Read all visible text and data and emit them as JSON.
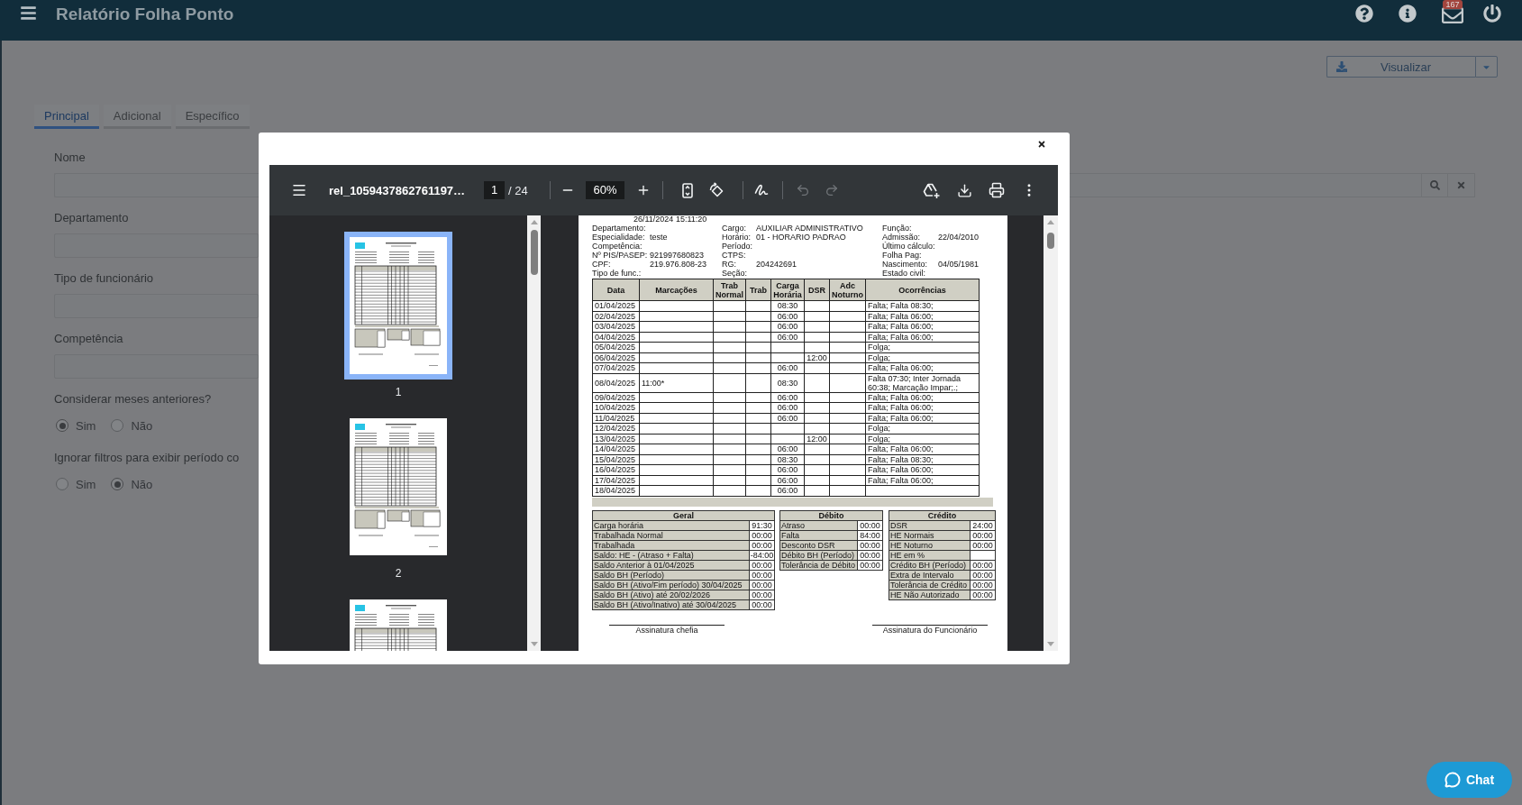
{
  "header": {
    "title": "Relatório Folha Ponto",
    "notification_count": "167"
  },
  "actions": {
    "view_button": "Visualizar"
  },
  "tabs": [
    {
      "label": "Principal",
      "selected": true
    },
    {
      "label": "Adicional",
      "selected": false
    },
    {
      "label": "Específico",
      "selected": false
    }
  ],
  "form": {
    "fields": [
      {
        "kind": "search",
        "label": "Nome"
      },
      {
        "kind": "text",
        "label": "Departamento"
      },
      {
        "kind": "text",
        "label": "Tipo de funcionário"
      },
      {
        "kind": "text",
        "label": "Competência"
      }
    ],
    "radio_groups": [
      {
        "label": "Considerar meses anteriores?",
        "options": [
          {
            "label": "Sim",
            "selected": true
          },
          {
            "label": "Não",
            "selected": false
          }
        ]
      },
      {
        "label": "Ignorar filtros para exibir período co",
        "options": [
          {
            "label": "Sim",
            "selected": false
          },
          {
            "label": "Não",
            "selected": true
          }
        ]
      }
    ]
  },
  "modal": {
    "viewer": {
      "file_name": "rel_1059437862761197…",
      "page": "1",
      "page_count": "/ 24",
      "zoom": "60%",
      "undo": {
        "disabled": true
      },
      "redo": {
        "disabled": true
      },
      "thumbnails": [
        {
          "label": "1",
          "selected": true
        },
        {
          "label": "2",
          "selected": false
        },
        {
          "selected": false
        }
      ],
      "document": {
        "timestamp": "26/11/2024 15:11:20",
        "info": [
          [
            {
              "label": "Departamento:"
            },
            {
              "label": "Cargo:",
              "value": "AUXILIAR ADMINISTRATIVO"
            },
            {
              "label": "Função:"
            }
          ],
          [
            {
              "label": "Especialidade:",
              "value": "teste"
            },
            {
              "label": "Horário:",
              "value": "01 - HORARIO PADRAO"
            },
            {
              "label": "Admissão:",
              "value": "22/04/2010"
            }
          ],
          [
            {
              "label": "Competência:"
            },
            {
              "label": "Período:"
            },
            {
              "label": "Último cálculo:"
            }
          ],
          [
            {
              "label": "Nº PIS/PASEP:",
              "value": "921997680823"
            },
            {
              "label": "CTPS:"
            },
            {
              "label": "Folha Pag:"
            }
          ],
          [
            {
              "label": "CPF:",
              "value": "219.976.808-23"
            },
            {
              "label": "RG:",
              "value": "204242691"
            },
            {
              "label": "Nascimento:",
              "value": "04/05/1981"
            }
          ],
          [
            {
              "label": "Tipo de func.:"
            },
            {
              "label": "Seção:"
            },
            {
              "label": "Estado civil:"
            }
          ]
        ],
        "table": {
          "columns": [
            "Data",
            "Marcações",
            "Trab Normal",
            "Trab",
            "Carga Horária",
            "DSR",
            "Adc Noturno",
            "Ocorrências"
          ],
          "rows": [
            {
              "data": "01/04/2025",
              "carga_horaria": "08:30",
              "ocorrencias": "Falta; Falta 08:30;"
            },
            {
              "data": "02/04/2025",
              "carga_horaria": "06:00",
              "ocorrencias": "Falta; Falta 06:00;"
            },
            {
              "data": "03/04/2025",
              "carga_horaria": "06:00",
              "ocorrencias": "Falta; Falta 06:00;"
            },
            {
              "data": "04/04/2025",
              "carga_horaria": "06:00",
              "ocorrencias": "Falta; Falta 06:00;"
            },
            {
              "data": "05/04/2025",
              "ocorrencias": "Folga;"
            },
            {
              "data": "06/04/2025",
              "dsr": "12:00",
              "ocorrencias": "Folga;"
            },
            {
              "data": "07/04/2025",
              "carga_horaria": "06:00",
              "ocorrencias": "Falta; Falta 06:00;"
            },
            {
              "data": "08/04/2025",
              "marcacoes": "11:00*",
              "carga_horaria": "08:30",
              "ocorrencias": "Falta 07:30; Inter Jornada 60:38; Marcação Impar;.;"
            },
            {
              "data": "09/04/2025",
              "carga_horaria": "06:00",
              "ocorrencias": "Falta; Falta 06:00;"
            },
            {
              "data": "10/04/2025",
              "carga_horaria": "06:00",
              "ocorrencias": "Falta; Falta 06:00;"
            },
            {
              "data": "11/04/2025",
              "carga_horaria": "06:00",
              "ocorrencias": "Falta; Falta 06:00;"
            },
            {
              "data": "12/04/2025",
              "ocorrencias": "Folga;"
            },
            {
              "data": "13/04/2025",
              "dsr": "12:00",
              "ocorrencias": "Folga;"
            },
            {
              "data": "14/04/2025",
              "carga_horaria": "06:00",
              "ocorrencias": "Falta; Falta 06:00;"
            },
            {
              "data": "15/04/2025",
              "carga_horaria": "08:30",
              "ocorrencias": "Falta; Falta 08:30;"
            },
            {
              "data": "16/04/2025",
              "carga_horaria": "06:00",
              "ocorrencias": "Falta; Falta 06:00;"
            },
            {
              "data": "17/04/2025",
              "carga_horaria": "06:00",
              "ocorrencias": "Falta; Falta 06:00;"
            },
            {
              "data": "18/04/2025",
              "carga_horaria": "06:00"
            }
          ]
        },
        "summary": [
          {
            "title": "Geral",
            "rows": [
              {
                "label": "Carga horária",
                "value": "91:30"
              },
              {
                "label": "Trabalhada Normal",
                "value": "00:00"
              },
              {
                "label": "Trabalhada",
                "value": "00:00"
              },
              {
                "label": "Saldo: HE - (Atraso + Falta)",
                "value": "-84:00"
              },
              {
                "label": "Saldo Anterior à 01/04/2025",
                "value": "00:00"
              },
              {
                "label": "Saldo BH (Período)",
                "value": "00:00"
              },
              {
                "label": "Saldo BH (Ativo/Fim período) 30/04/2025",
                "value": "00:00"
              },
              {
                "label": "Saldo BH (Ativo) até 20/02/2026",
                "value": "00:00"
              },
              {
                "label": "Saldo BH (Ativo/Inativo) até 30/04/2025",
                "value": "00:00"
              }
            ]
          },
          {
            "title": "Débito",
            "rows": [
              {
                "label": "Atraso",
                "value": "00:00"
              },
              {
                "label": "Falta",
                "value": "84:00"
              },
              {
                "label": "Desconto DSR",
                "value": "00:00"
              },
              {
                "label": "Débito BH (Período)",
                "value": "00:00"
              },
              {
                "label": "Tolerância de Débito",
                "value": "00:00"
              }
            ]
          },
          {
            "title": "Crédito",
            "rows": [
              {
                "label": "DSR",
                "value": "24:00"
              },
              {
                "label": "HE Normais",
                "value": "00:00"
              },
              {
                "label": "HE Noturno",
                "value": "00:00"
              },
              {
                "label": "HE em %"
              },
              {
                "label": "Crédito BH (Período)",
                "value": "00:00"
              },
              {
                "label": "Extra de Intervalo",
                "value": "00:00"
              },
              {
                "label": "Tolerância de Crédito",
                "value": "00:00"
              },
              {
                "label": "HE Não Autorizado",
                "value": "00:00"
              }
            ]
          }
        ],
        "signatures": [
          "Assinatura chefia",
          "Assinatura do Funcionário"
        ]
      }
    }
  },
  "chat_button": "Chat"
}
